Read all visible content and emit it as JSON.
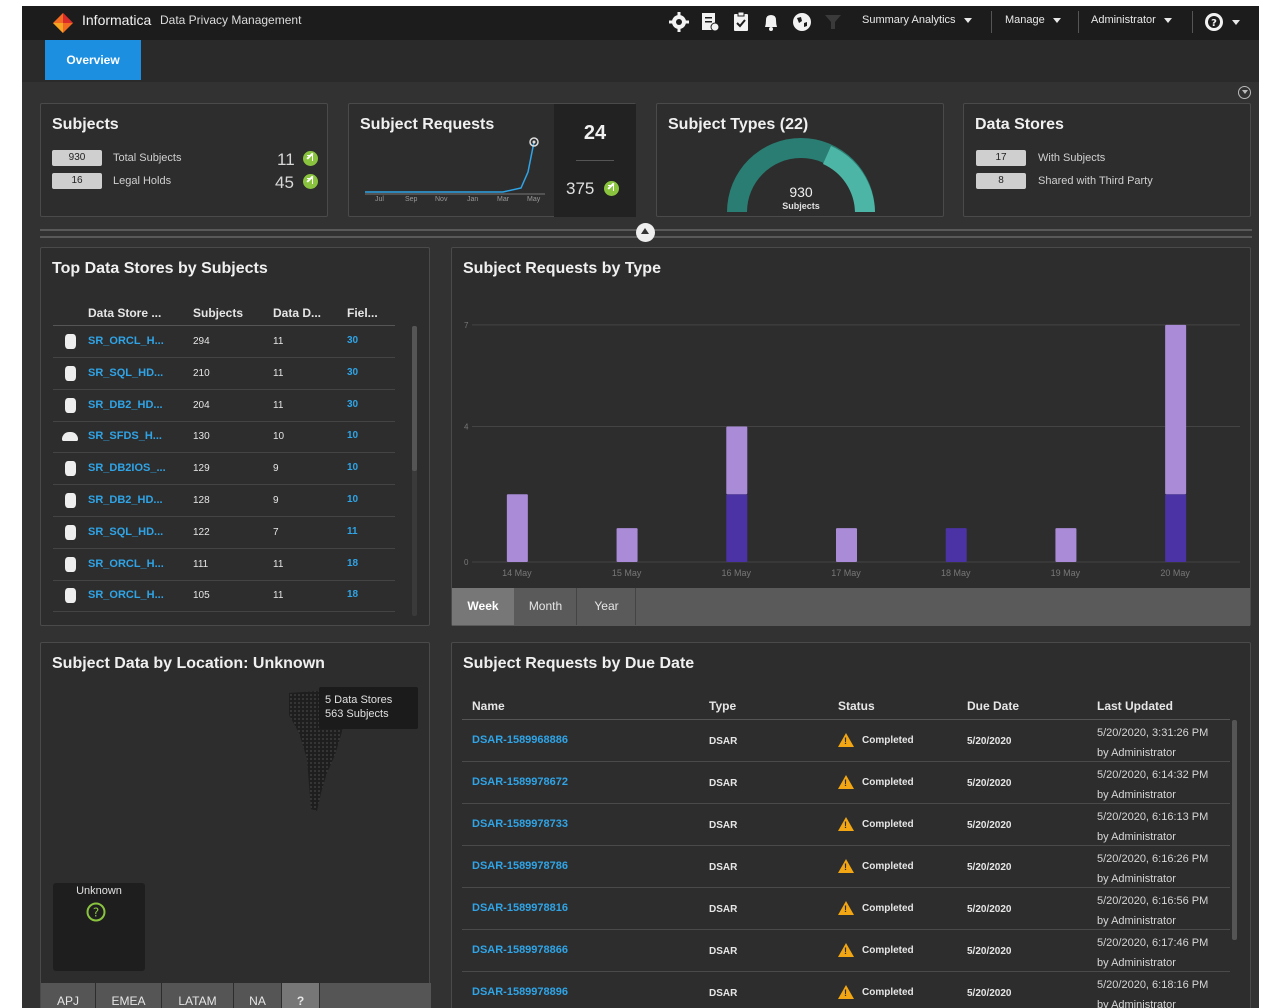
{
  "header": {
    "brand": "Informatica",
    "product": "Data Privacy Management",
    "menus": [
      "Summary Analytics",
      "Manage",
      "Administrator"
    ],
    "icons": [
      "gear-icon",
      "report-icon",
      "clipboard-icon",
      "bell-icon",
      "globe-icon",
      "filter-icon",
      "help-icon"
    ]
  },
  "tabs": {
    "overview": "Overview"
  },
  "subjects": {
    "title": "Subjects",
    "total_value": "930",
    "total_label": "Total Subjects",
    "total_trend": "11",
    "legal_value": "16",
    "legal_label": "Legal Holds",
    "legal_trend": "45"
  },
  "subject_requests": {
    "title": "Subject Requests",
    "month_labels": [
      "Jul",
      "Sep",
      "Nov",
      "Jan",
      "Mar",
      "May"
    ],
    "count": "24",
    "total": "375"
  },
  "subject_types": {
    "title": "Subject Types (22)",
    "gauge_value": "930",
    "gauge_label": "Subjects"
  },
  "data_stores": {
    "title": "Data Stores",
    "with_value": "17",
    "with_label": "With Subjects",
    "third_value": "8",
    "third_label": "Shared with Third Party"
  },
  "top_stores": {
    "title": "Top Data Stores by Subjects",
    "columns": [
      "Data Store ...",
      "Subjects",
      "Data D...",
      "Fiel..."
    ],
    "rows": [
      {
        "name": "SR_ORCL_H...",
        "subjects": "294",
        "data": "11",
        "fields": "30",
        "icon": "database-icon"
      },
      {
        "name": "SR_SQL_HD...",
        "subjects": "210",
        "data": "11",
        "fields": "30",
        "icon": "database-icon"
      },
      {
        "name": "SR_DB2_HD...",
        "subjects": "204",
        "data": "11",
        "fields": "30",
        "icon": "database-icon"
      },
      {
        "name": "SR_SFDS_H...",
        "subjects": "130",
        "data": "10",
        "fields": "10",
        "icon": "cloud-icon"
      },
      {
        "name": "SR_DB2IOS_...",
        "subjects": "129",
        "data": "9",
        "fields": "10",
        "icon": "database-icon"
      },
      {
        "name": "SR_DB2_HD...",
        "subjects": "128",
        "data": "9",
        "fields": "10",
        "icon": "database-icon"
      },
      {
        "name": "SR_SQL_HD...",
        "subjects": "122",
        "data": "7",
        "fields": "11",
        "icon": "database-icon"
      },
      {
        "name": "SR_ORCL_H...",
        "subjects": "111",
        "data": "11",
        "fields": "18",
        "icon": "database-icon"
      },
      {
        "name": "SR_ORCL_H...",
        "subjects": "105",
        "data": "11",
        "fields": "18",
        "icon": "database-icon"
      }
    ]
  },
  "requests_by_type": {
    "title": "Subject Requests by Type",
    "range_tabs": [
      "Week",
      "Month",
      "Year"
    ],
    "active_range": "Week"
  },
  "chart_data": {
    "type": "bar",
    "title": "Subject Requests by Type",
    "categories": [
      "14 May",
      "15 May",
      "16 May",
      "17 May",
      "18 May",
      "19 May",
      "20 May"
    ],
    "series": [
      {
        "values": [
          0,
          0,
          2,
          0,
          1,
          0,
          2
        ],
        "color": "#4b32a5"
      },
      {
        "values": [
          2,
          1,
          2,
          1,
          0,
          1,
          5
        ],
        "color": "#a98bd8"
      }
    ],
    "yticks": [
      0,
      4,
      7
    ],
    "ylim": [
      0,
      7.5
    ],
    "stacked": true,
    "grid": true
  },
  "location": {
    "title": "Subject Data by Location: Unknown",
    "tooltip_stores": "5 Data Stores",
    "tooltip_subjects": "563 Subjects",
    "unknown_label": "Unknown",
    "region_tabs": [
      "APJ",
      "EMEA",
      "LATAM",
      "NA",
      "?"
    ]
  },
  "due_date": {
    "title": "Subject Requests by Due Date",
    "columns": [
      "Name",
      "Type",
      "Status",
      "Due Date",
      "Last Updated"
    ],
    "rows": [
      {
        "name": "DSAR-1589968886",
        "type": "DSAR",
        "status": "Completed",
        "due": "5/20/2020",
        "updated": "5/20/2020, 3:31:26 PM",
        "by": "by Administrator"
      },
      {
        "name": "DSAR-1589978672",
        "type": "DSAR",
        "status": "Completed",
        "due": "5/20/2020",
        "updated": "5/20/2020, 6:14:32 PM",
        "by": "by Administrator"
      },
      {
        "name": "DSAR-1589978733",
        "type": "DSAR",
        "status": "Completed",
        "due": "5/20/2020",
        "updated": "5/20/2020, 6:16:13 PM",
        "by": "by Administrator"
      },
      {
        "name": "DSAR-1589978786",
        "type": "DSAR",
        "status": "Completed",
        "due": "5/20/2020",
        "updated": "5/20/2020, 6:16:26 PM",
        "by": "by Administrator"
      },
      {
        "name": "DSAR-1589978816",
        "type": "DSAR",
        "status": "Completed",
        "due": "5/20/2020",
        "updated": "5/20/2020, 6:16:56 PM",
        "by": "by Administrator"
      },
      {
        "name": "DSAR-1589978866",
        "type": "DSAR",
        "status": "Completed",
        "due": "5/20/2020",
        "updated": "5/20/2020, 6:17:46 PM",
        "by": "by Administrator"
      },
      {
        "name": "DSAR-1589978896",
        "type": "DSAR",
        "status": "Completed",
        "due": "5/20/2020",
        "updated": "5/20/2020, 6:18:16 PM",
        "by": "by Administrator"
      }
    ]
  }
}
